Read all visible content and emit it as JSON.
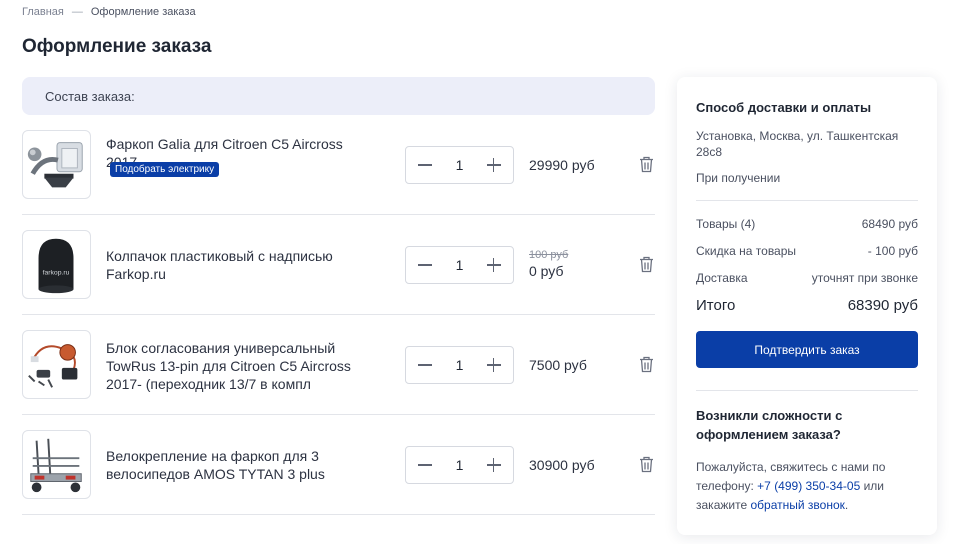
{
  "breadcrumb": {
    "home": "Главная",
    "separator": "—",
    "current": "Оформление заказа"
  },
  "page_title": "Оформление заказа",
  "order_header": "Состав заказа:",
  "items": [
    {
      "name": "Фаркоп Galia для Citroen C5 Aircross 2017-",
      "badge": "Подобрать электрику",
      "qty": "1",
      "price": "29990 руб",
      "old_price": ""
    },
    {
      "name": "Колпачок пластиковый с надписью Farkop.ru",
      "badge": "",
      "qty": "1",
      "price": "0 руб",
      "old_price": "100 руб"
    },
    {
      "name": "Блок согласования универсальный TowRus 13-pin для Citroen C5 Aircross 2017- (переходник 13/7 в компл",
      "badge": "",
      "qty": "1",
      "price": "7500 руб",
      "old_price": ""
    },
    {
      "name": "Велокрепление на фаркоп для 3 велосипедов AMOS TYTAN 3 plus",
      "badge": "",
      "qty": "1",
      "price": "30900 руб",
      "old_price": ""
    }
  ],
  "thumb_labels": {
    "cap": "farkop.ru"
  },
  "summary": {
    "title": "Способ доставки и оплаты",
    "address": "Установка, Москва, ул. Ташкентская 28с8",
    "payment": "При получении",
    "goods_label": "Товары (4)",
    "goods_value": "68490 руб",
    "discount_label": "Скидка на товары",
    "discount_value": "- 100 руб",
    "delivery_label": "Доставка",
    "delivery_value": "уточнят при звонке",
    "total_label": "Итого",
    "total_value": "68390 руб",
    "confirm_label": "Подтвердить заказ",
    "help_title": "Возникли сложности с оформлением заказа?",
    "help_text_1": "Пожалуйста, свяжитесь с нами по телефону:",
    "help_phone": "+7 (499) 350-34-05",
    "help_text_2": "или закажите",
    "help_callback": "обратный звонок",
    "help_text_3": "."
  },
  "colors": {
    "accent": "#0a3ea7",
    "header_bg": "#eceef9"
  },
  "icons": {
    "minus": "minus-icon",
    "plus": "plus-icon",
    "trash": "trash-icon"
  }
}
